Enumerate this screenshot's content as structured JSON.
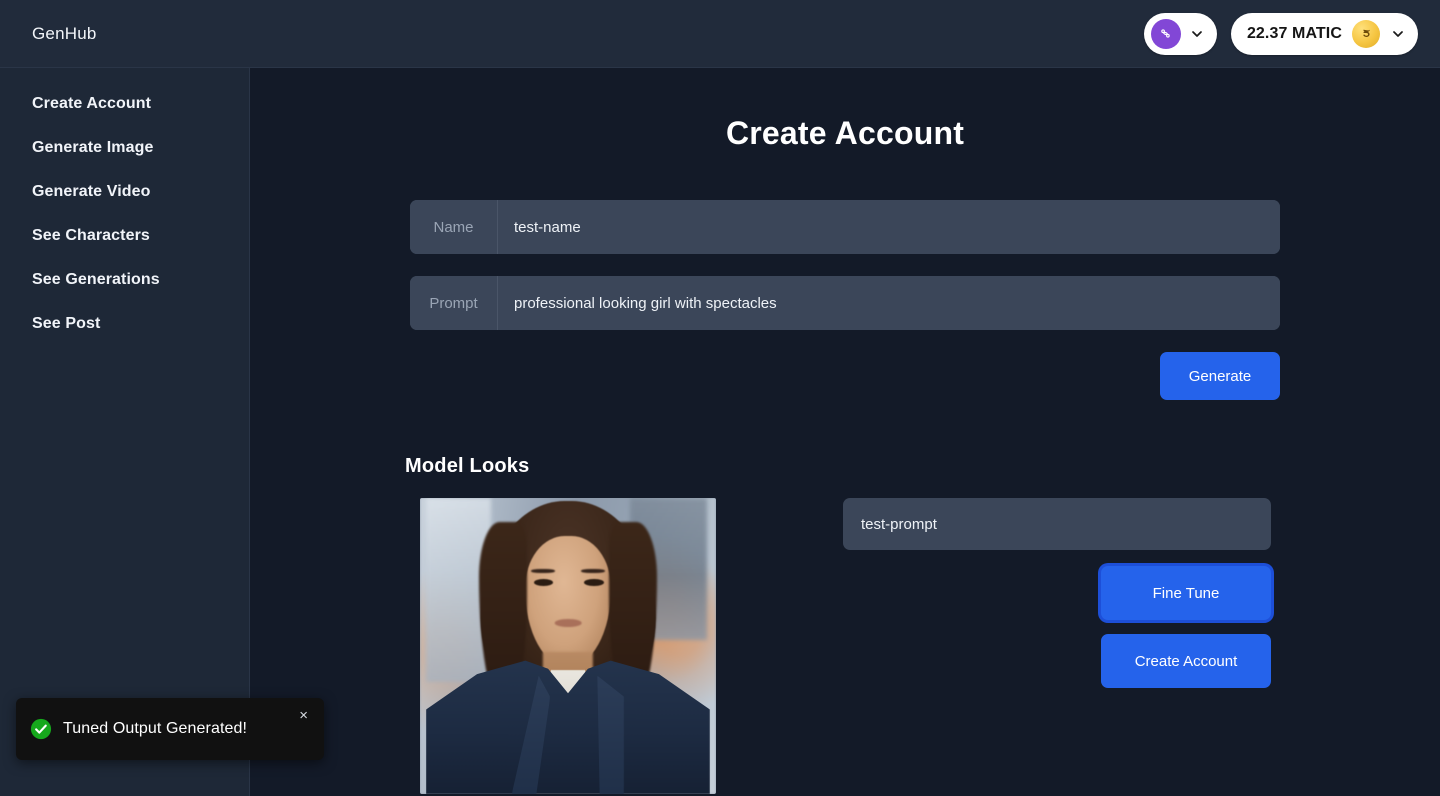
{
  "header": {
    "brand": "GenHub",
    "wallet_pill": {
      "icon": "polygon-wallet-icon",
      "chevron": "chevron-down-icon"
    },
    "balance_pill": {
      "balance": "22.37 MATIC",
      "coin_icon": "coin-icon",
      "coin_glyph": "💰",
      "chevron": "chevron-down-icon"
    }
  },
  "sidebar": {
    "items": [
      {
        "label": "Create Account",
        "name": "sidebar-item-create-account"
      },
      {
        "label": "Generate Image",
        "name": "sidebar-item-generate-image"
      },
      {
        "label": "Generate Video",
        "name": "sidebar-item-generate-video"
      },
      {
        "label": "See Characters",
        "name": "sidebar-item-see-characters"
      },
      {
        "label": "See Generations",
        "name": "sidebar-item-see-generations"
      },
      {
        "label": "See Post",
        "name": "sidebar-item-see-post"
      }
    ]
  },
  "main": {
    "page_title": "Create Account",
    "fields": [
      {
        "label": "Name",
        "value": "test-name",
        "placeholder": "Name"
      },
      {
        "label": "Prompt",
        "value": "professional looking girl with spectacles",
        "placeholder": "Prompt"
      }
    ],
    "generate_button": "Generate",
    "model_looks": {
      "section_title": "Model Looks",
      "image_alt": "professional looking girl with spectacles",
      "prompt_value": "test-prompt",
      "prompt_placeholder": "test-prompt",
      "fine_tune_button": "Fine Tune",
      "create_account_button": "Create Account"
    }
  },
  "toast": {
    "message": "Tuned Output Generated!",
    "icon": "check-circle-icon",
    "close_label": "×"
  },
  "colors": {
    "header_bg": "#212b3b",
    "sidebar_bg": "#1e2837",
    "content_bg": "#131a28",
    "field_bg": "#3b4659",
    "accent_blue": "#2563eb",
    "focus_ring": "#1d4fd8",
    "toast_bg": "#111111",
    "success_green": "#22c55e",
    "wallet_purple": "#8247d6",
    "coin_yellow": "#f5c542"
  }
}
